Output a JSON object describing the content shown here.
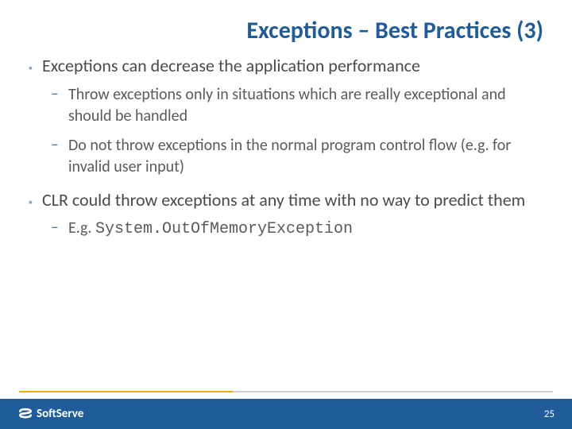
{
  "title": "Exceptions – Best Practices (3)",
  "bullets": [
    {
      "text": "Exceptions can decrease the application performance",
      "sub": [
        "Throw exceptions only in situations which are really exceptional and should be handled",
        "Do not throw exceptions in the normal program control flow (e.g. for invalid user input)"
      ]
    },
    {
      "text": "CLR could throw exceptions at any time with no way to predict them",
      "sub_prefix": "E.g. ",
      "sub_code": "System.OutOfMemoryException"
    }
  ],
  "footer": {
    "brand": "SoftServe",
    "page": "25"
  }
}
